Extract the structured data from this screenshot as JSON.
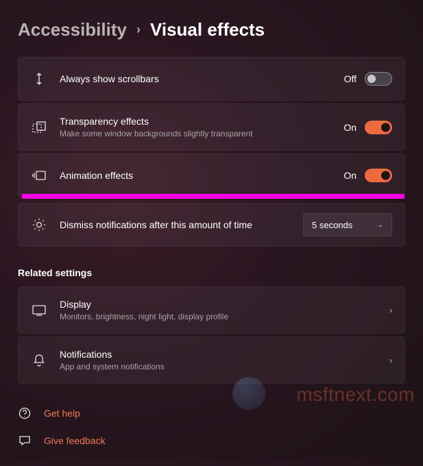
{
  "breadcrumb": {
    "parent": "Accessibility",
    "current": "Visual effects"
  },
  "settings": {
    "scrollbars": {
      "title": "Always show scrollbars",
      "state": "Off",
      "enabled": false
    },
    "transparency": {
      "title": "Transparency effects",
      "sub": "Make some window backgrounds slightly transparent",
      "state": "On",
      "enabled": true
    },
    "animation": {
      "title": "Animation effects",
      "state": "On",
      "enabled": true
    },
    "dismiss": {
      "title": "Dismiss notifications after this amount of time",
      "selected": "5 seconds"
    }
  },
  "related": {
    "header": "Related settings",
    "display": {
      "title": "Display",
      "sub": "Monitors, brightness, night light, display profile"
    },
    "notifications": {
      "title": "Notifications",
      "sub": "App and system notifications"
    }
  },
  "links": {
    "help": "Get help",
    "feedback": "Give feedback"
  },
  "watermark": "msftnext.com"
}
